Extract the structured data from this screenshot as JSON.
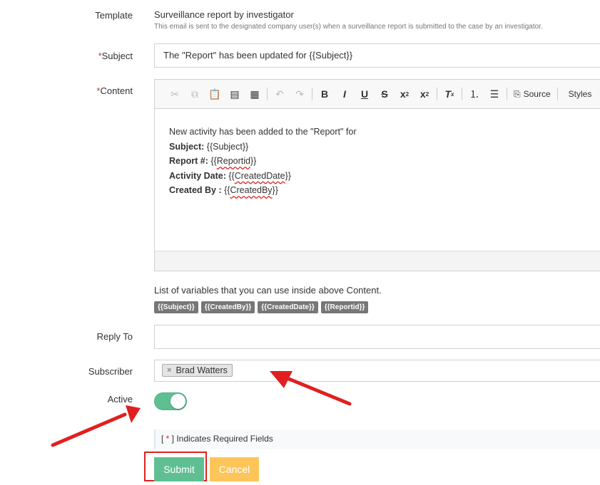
{
  "template": {
    "label": "Template",
    "name": "Surveillance report by investigator",
    "description": "This email is sent to the designated company user(s) when a surveillance report is submitted to the case by an investigator."
  },
  "subject": {
    "label": "Subject",
    "required_mark": "*",
    "value": "The \"Report\" has been updated for {{Subject}}"
  },
  "content": {
    "label": "Content",
    "required_mark": "*",
    "toolbar": {
      "source_label": "Source",
      "styles_label": "Styles"
    },
    "body": {
      "line1": "New activity has been added to the \"Report\" for",
      "subject_key": "Subject:",
      "subject_val": "{{Subject}}",
      "report_key": "Report #:",
      "report_pre": "{{",
      "report_var": "Reportid",
      "report_post": "}}",
      "date_key": "Activity Date:",
      "date_pre": "{{",
      "date_var": "CreatedDate",
      "date_post": "}}",
      "by_key": "Created By :",
      "by_pre": "{{",
      "by_var": "CreatedBy",
      "by_post": "}}"
    }
  },
  "variables": {
    "title": "List of variables that you can use inside above Content.",
    "items": [
      "{{Subject}}",
      "{{CreatedBy}}",
      "{{CreatedDate}}",
      "{{Reportid}}"
    ]
  },
  "reply_to": {
    "label": "Reply To",
    "value": ""
  },
  "subscriber": {
    "label": "Subscriber",
    "chip": "Brad Watters",
    "chip_remove": "×"
  },
  "active": {
    "label": "Active",
    "on": true
  },
  "required_note": {
    "open": "[ ",
    "mark": "*",
    "close": " ] Indicates Required Fields"
  },
  "buttons": {
    "submit": "Submit",
    "cancel": "Cancel"
  },
  "colors": {
    "accent": "#5fbf93",
    "cancel": "#fcc55a",
    "annotation": "#e02020",
    "required": "#c0392b"
  }
}
